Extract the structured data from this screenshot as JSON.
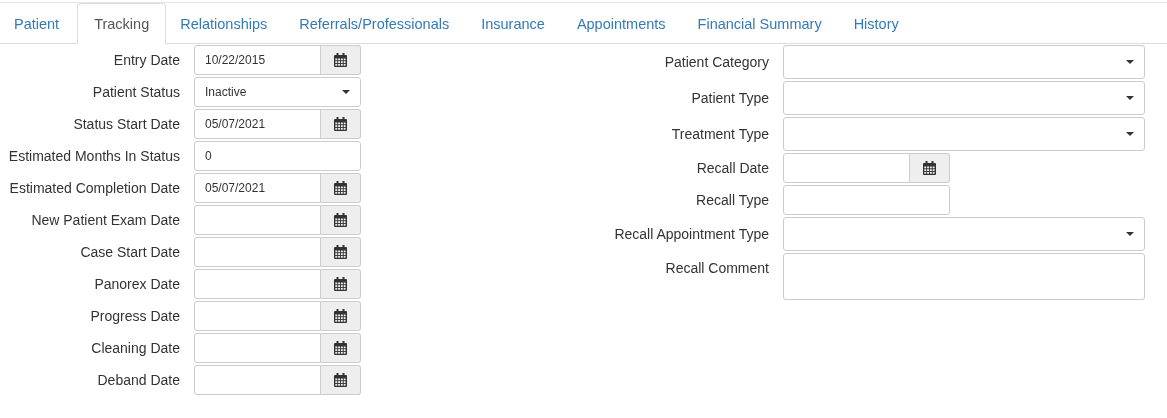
{
  "tabs": [
    {
      "label": "Patient",
      "selected": false
    },
    {
      "label": "Tracking",
      "selected": true
    },
    {
      "label": "Relationships",
      "selected": false
    },
    {
      "label": "Referrals/Professionals",
      "selected": false
    },
    {
      "label": "Insurance",
      "selected": false
    },
    {
      "label": "Appointments",
      "selected": false
    },
    {
      "label": "Financial Summary",
      "selected": false
    },
    {
      "label": "History",
      "selected": false
    }
  ],
  "left_fields": [
    {
      "label": "Entry Date",
      "kind": "date",
      "value": "10/22/2015"
    },
    {
      "label": "Patient Status",
      "kind": "select",
      "value": "Inactive"
    },
    {
      "label": "Status Start Date",
      "kind": "date",
      "value": "05/07/2021"
    },
    {
      "label": "Estimated Months In Status",
      "kind": "text",
      "value": "0"
    },
    {
      "label": "Estimated Completion Date",
      "kind": "date",
      "value": "05/07/2021"
    },
    {
      "label": "New Patient Exam Date",
      "kind": "date"
    },
    {
      "label": "Case Start Date",
      "kind": "date"
    },
    {
      "label": "Panorex Date",
      "kind": "date"
    },
    {
      "label": "Progress Date",
      "kind": "date"
    },
    {
      "label": "Cleaning Date",
      "kind": "date"
    },
    {
      "label": "Deband Date",
      "kind": "date"
    }
  ],
  "right_fields": [
    {
      "label": "Patient Category",
      "kind": "select"
    },
    {
      "label": "Patient Type",
      "kind": "select"
    },
    {
      "label": "Treatment Type",
      "kind": "select"
    },
    {
      "label": "Recall Date",
      "kind": "date"
    },
    {
      "label": "Recall Type",
      "kind": "text"
    },
    {
      "label": "Recall Appointment Type",
      "kind": "select"
    },
    {
      "label": "Recall Comment",
      "kind": "textarea"
    }
  ]
}
